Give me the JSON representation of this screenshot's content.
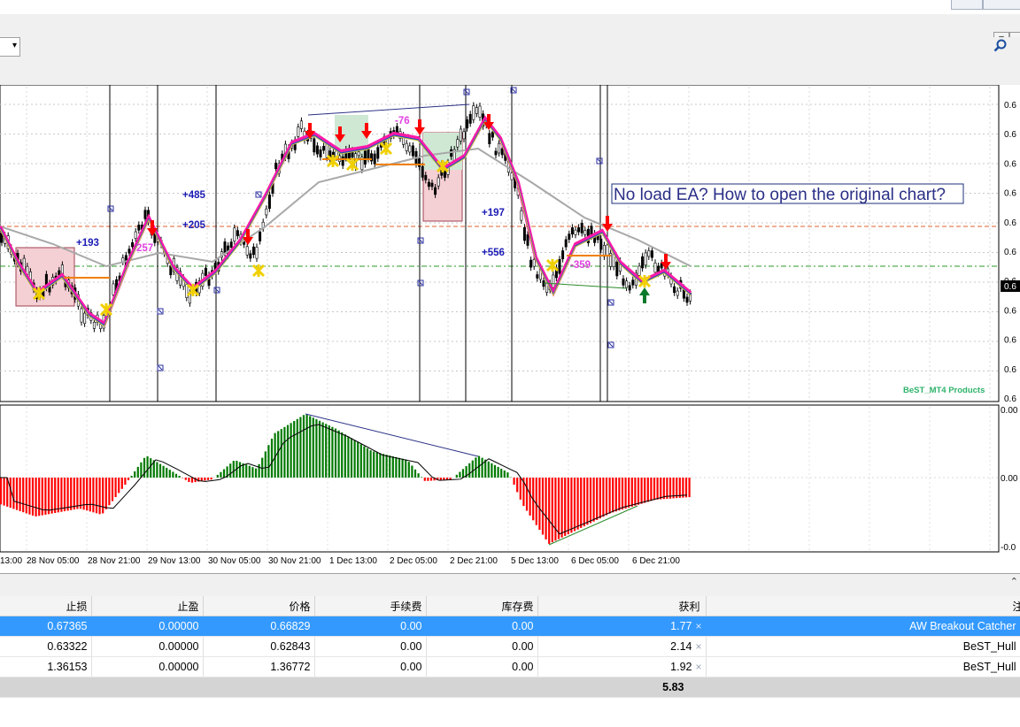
{
  "chart": {
    "notice": "No load EA? How to open the original chart?",
    "watermark": "BeST_MT4 Products",
    "price_axis_labels": [
      "0.6",
      "0.6",
      "0.6",
      "0.6",
      "0.6",
      "0.6",
      "0.6",
      "0.6",
      "0.6",
      "0.6",
      "0.6"
    ],
    "current_price_tag": "0.6",
    "osc_axis_labels": [
      "0.00",
      "0.00",
      "-0.0"
    ],
    "time_labels": [
      "13:00",
      "28 Nov 05:00",
      "28 Nov 21:00",
      "29 Nov 13:00",
      "30 Nov 05:00",
      "30 Nov 21:00",
      "1 Dec 13:00",
      "2 Dec 05:00",
      "2 Dec 21:00",
      "5 Dec 13:00",
      "6 Dec 05:00",
      "6 Dec 21:00"
    ],
    "trade_labels": [
      "+193",
      "+485",
      "+205",
      "-76",
      "+197",
      "+556",
      "-359",
      "257"
    ],
    "colors": {
      "up": "#007a00",
      "down": "#ff0000",
      "hull": "#ff1aa8",
      "ma": "#a8a8a8",
      "signal": "#000000"
    }
  },
  "terminal": {
    "headers": [
      "止损",
      "止盈",
      "价格",
      "手续费",
      "库存费",
      "获利",
      "注"
    ],
    "rows": [
      {
        "sl": "0.67365",
        "tp": "0.00000",
        "price": "0.66829",
        "commission": "0.00",
        "swap": "0.00",
        "profit": "1.77",
        "comment": "AW Breakout Catcher",
        "selected": true
      },
      {
        "sl": "0.63322",
        "tp": "0.00000",
        "price": "0.62843",
        "commission": "0.00",
        "swap": "0.00",
        "profit": "2.14",
        "comment": "BeST_Hull",
        "selected": false
      },
      {
        "sl": "1.36153",
        "tp": "0.00000",
        "price": "1.36772",
        "commission": "0.00",
        "swap": "0.00",
        "profit": "1.92",
        "comment": "BeST_Hull",
        "selected": false
      }
    ],
    "total_profit": "5.83",
    "close_glyph": "×"
  },
  "toolbar": {
    "dropdown_glyph": "▾",
    "minimize_glyph": "–",
    "search_icon": "magnifier"
  }
}
